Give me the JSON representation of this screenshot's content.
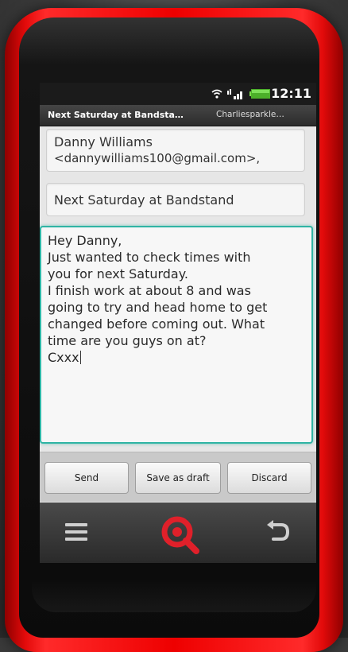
{
  "status_bar": {
    "time": "12:11",
    "icons": [
      "wifi-icon",
      "signal-icon",
      "battery-icon"
    ]
  },
  "title_bar": {
    "subject": "Next Saturday at Bandsta…",
    "account": "Charliesparkle…"
  },
  "compose": {
    "to_name": "Danny Williams",
    "to_email": "<dannywilliams100@gmail.com>,",
    "subject": "Next Saturday at Bandstand",
    "body_lines": [
      "Hey Danny,",
      "Just wanted to check times with",
      "you for next Saturday.",
      "I finish work at about 8 and was",
      "going to try and head home to get",
      "changed before coming out. What",
      "time are you guys on at?",
      "Cxxx"
    ]
  },
  "buttons": {
    "send": "Send",
    "save_draft": "Save as draft",
    "discard": "Discard"
  },
  "nav": {
    "icons": [
      "menu-icon",
      "search-icon",
      "back-icon"
    ]
  },
  "colors": {
    "phone_red": "#e00000",
    "focus_border": "#2fb4a4",
    "search_icon": "#e0202a"
  }
}
